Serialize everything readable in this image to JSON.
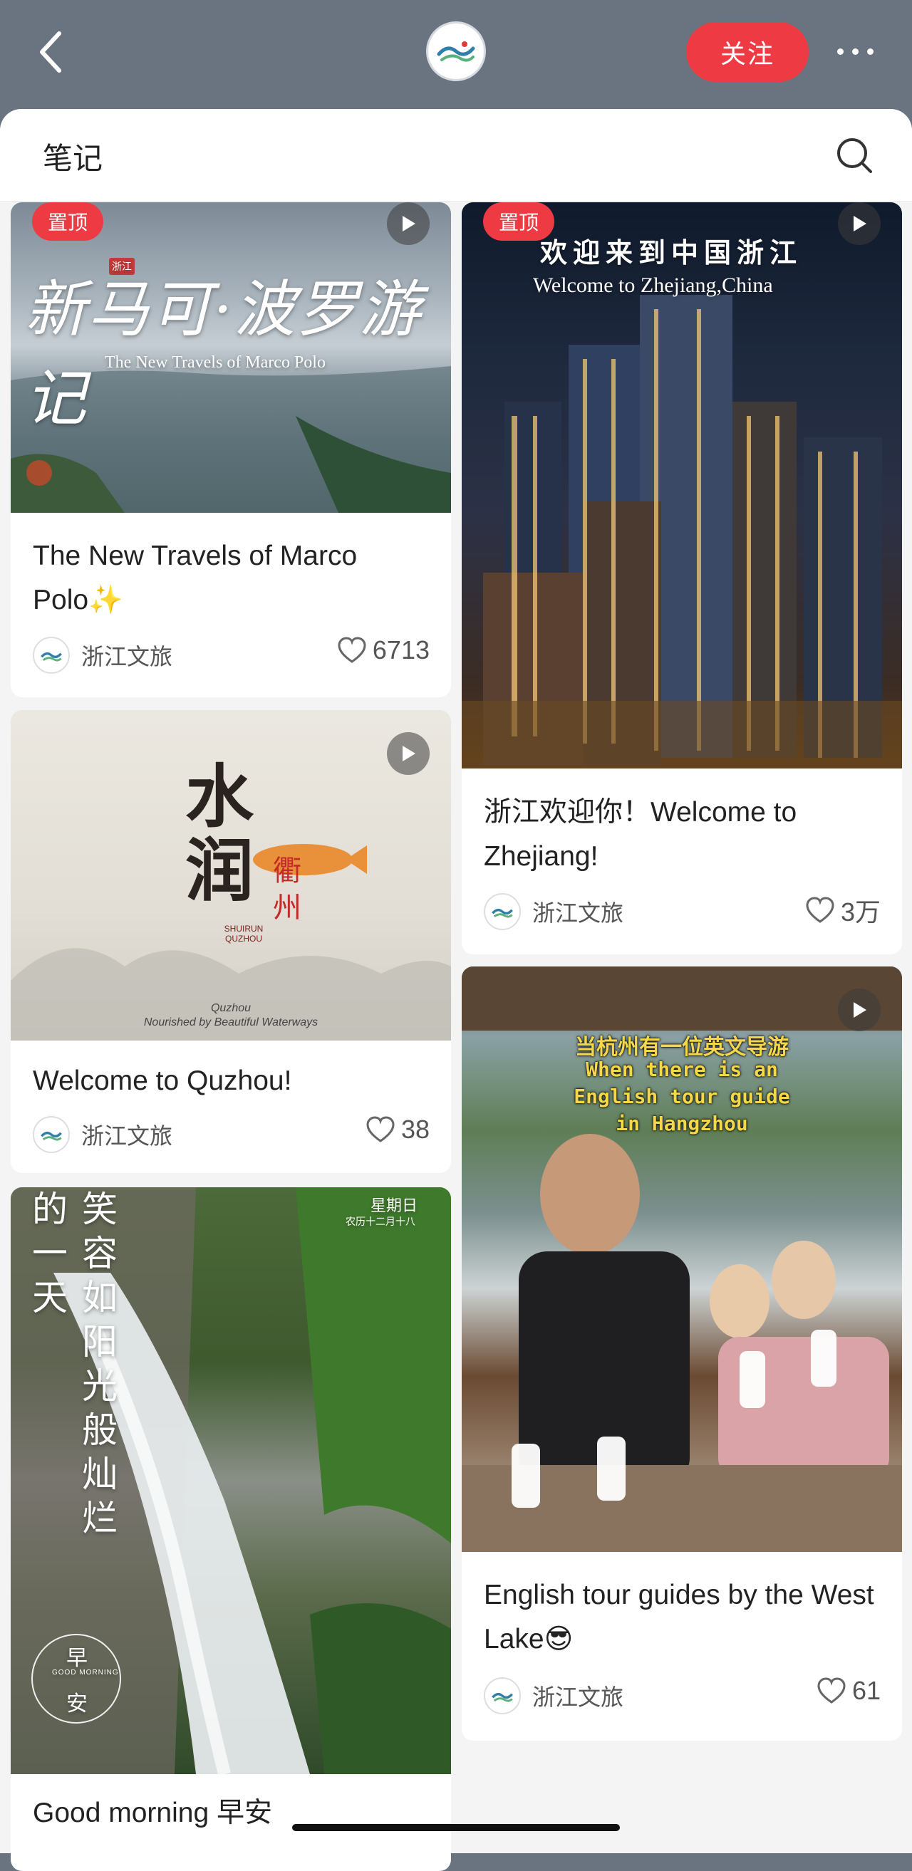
{
  "header": {
    "follow_label": "关注"
  },
  "sheet": {
    "title": "笔记"
  },
  "cards": [
    {
      "pin_label": "置顶",
      "title": "The New Travels of Marco Polo✨",
      "author": "浙江文旅",
      "likes": "6713",
      "thumb_title": "新马可·波罗游记",
      "thumb_subtitle": "The New Travels of Marco Polo",
      "thumb_tag": "浙江"
    },
    {
      "pin_label": "置顶",
      "title": "浙江欢迎你！Welcome to Zhejiang!",
      "author": "浙江文旅",
      "likes": "3万",
      "thumb_title": "欢迎来到中国浙江",
      "thumb_subtitle": "Welcome to Zhejiang,China"
    },
    {
      "title": "Welcome to Quzhou!",
      "author": "浙江文旅",
      "likes": "38",
      "thumb_title": "水润",
      "thumb_seal": "衢州",
      "thumb_brand": "SHUIRUN QUZHOU",
      "thumb_caption_1": "Quzhou",
      "thumb_caption_2": "Nourished by Beautiful Waterways"
    },
    {
      "title": "English tour guides by the West Lake😎",
      "author": "浙江文旅",
      "likes": "61",
      "thumb_line_1": "当杭州有一位英文导游",
      "thumb_line_2": "When there is an",
      "thumb_line_3": "English tour guide",
      "thumb_line_4": "in Hangzhou"
    },
    {
      "title": "Good morning 早安",
      "thumb_weekday": "星期日",
      "thumb_lunar": "农历十二月十八",
      "thumb_poem": "笑容如阳光般灿烂",
      "thumb_poem_2": "的一天",
      "thumb_badge": "早安",
      "thumb_badge_en": "GOOD MORNING"
    }
  ],
  "colors": {
    "accent": "#ee3a43",
    "topbar": "#6a7480"
  },
  "icons": [
    "back-icon",
    "brand-logo-icon",
    "more-icon",
    "search-icon",
    "play-icon",
    "heart-icon"
  ]
}
